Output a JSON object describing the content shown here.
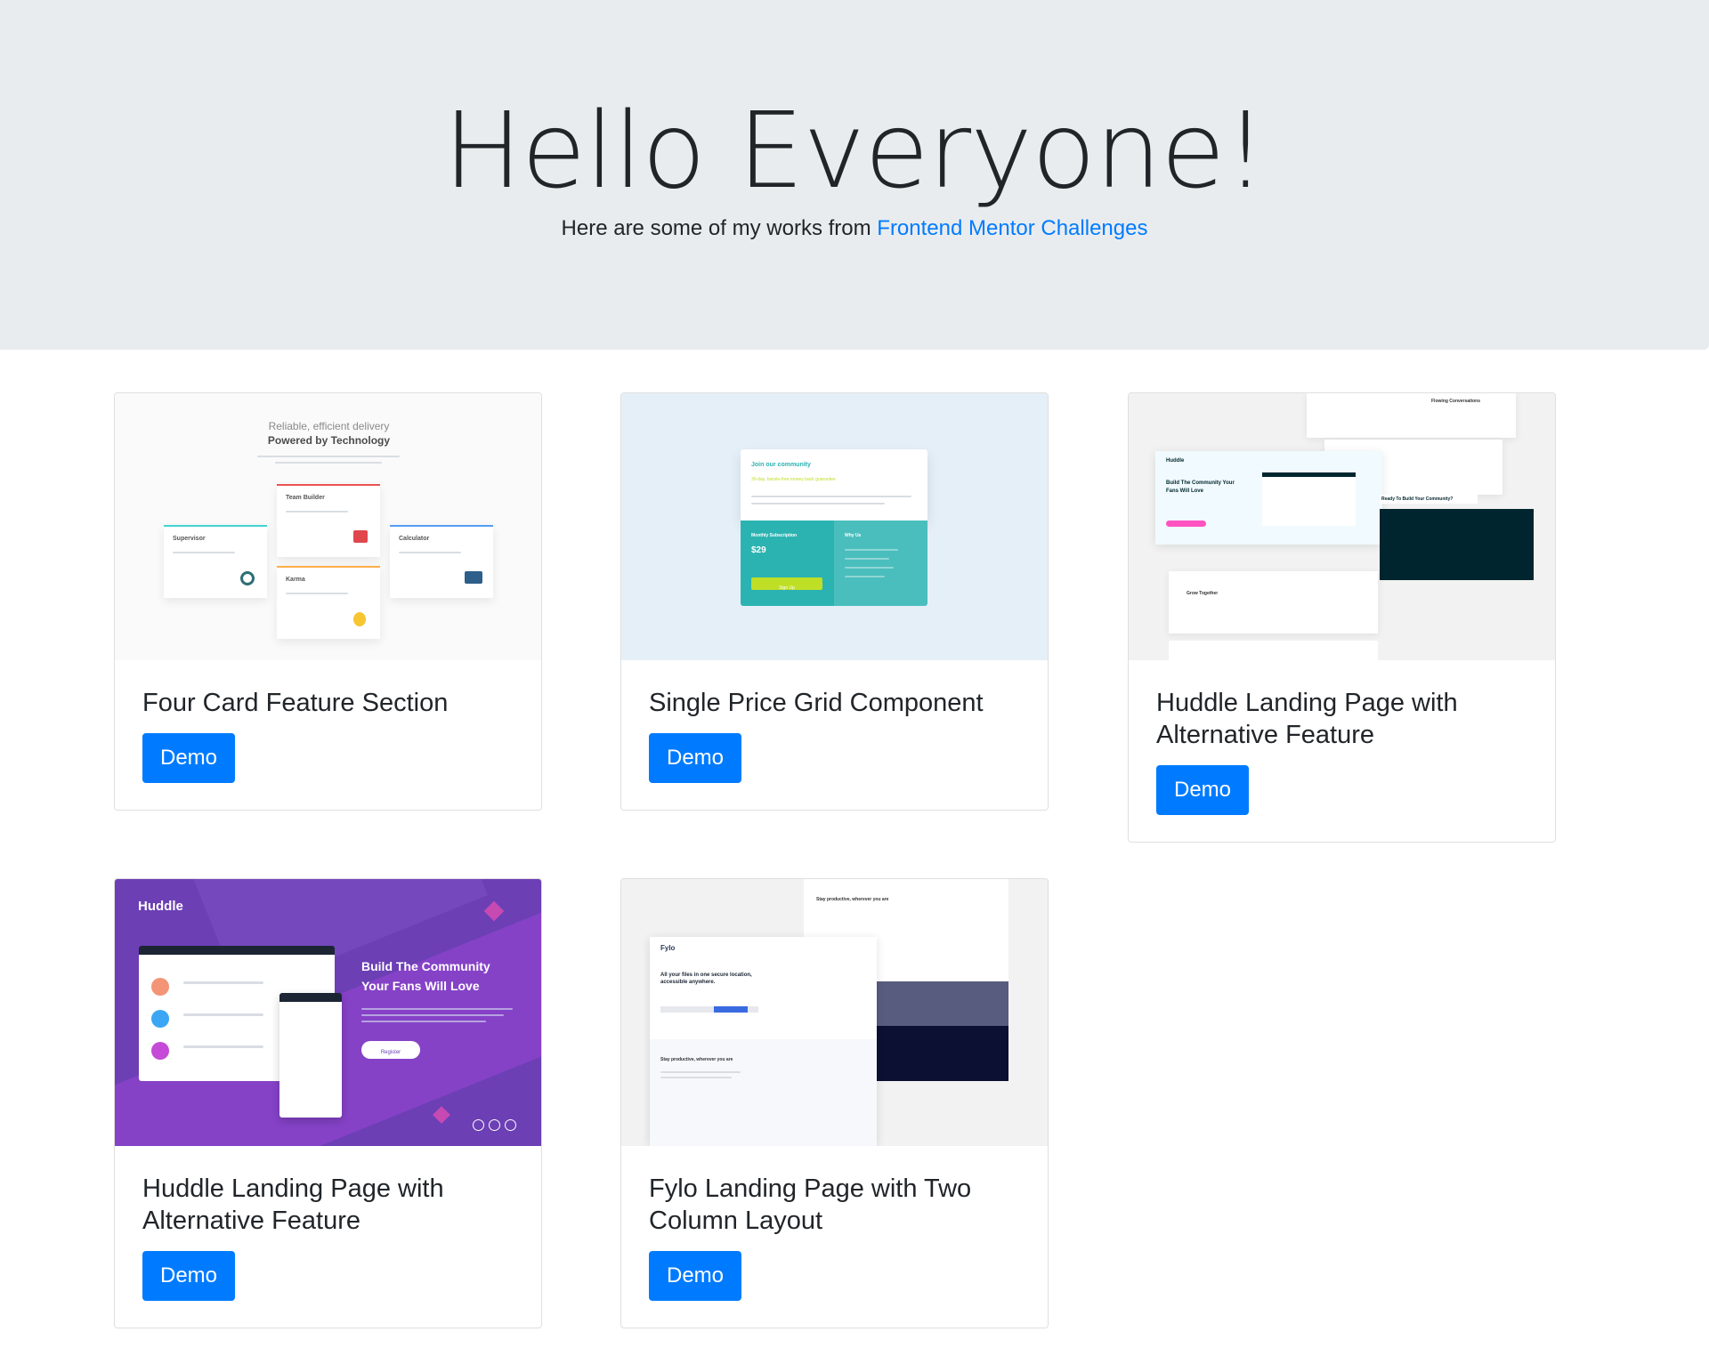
{
  "header": {
    "title": "Hello Everyone!",
    "subtitle_prefix": "Here are some of my works from ",
    "subtitle_link": "Frontend Mentor Challenges"
  },
  "cards": [
    {
      "title": "Four Card Feature Section",
      "button": "Demo",
      "preview": {
        "heading_light": "Reliable, efficient delivery",
        "heading_bold": "Powered by Technology",
        "cards": [
          "Supervisor",
          "Team Builder",
          "Karma",
          "Calculator"
        ]
      }
    },
    {
      "title": "Single Price Grid Component",
      "button": "Demo",
      "preview": {
        "join": "Join our community",
        "guarantee": "30-day, hassle-free money back guarantee",
        "monthly": "Monthly Subscription",
        "price": "$29",
        "why": "Why Us",
        "signup": "Sign Up"
      }
    },
    {
      "title": "Huddle Landing Page with Alternative Feature",
      "button": "Demo",
      "preview": {
        "logo": "Huddle",
        "headline": "Build The Community Your Fans Will Love",
        "flowing": "Flowing Conversations",
        "grow": "Grow Together",
        "ready": "Ready To Build Your Community?"
      }
    },
    {
      "title": "Huddle Landing Page with Alternative Feature",
      "button": "Demo",
      "preview": {
        "logo": "Huddle",
        "headline_1": "Build The Community",
        "headline_2": "Your Fans Will Love",
        "register": "Register"
      }
    },
    {
      "title": "Fylo Landing Page with Two Column Layout",
      "button": "Demo",
      "preview": {
        "logo": "Fylo",
        "headline": "All your files in one secure location, accessible anywhere.",
        "productive": "Stay productive, wherever you are"
      }
    }
  ],
  "colors": {
    "jumbotron_bg": "#e9ecef",
    "primary": "#007bff",
    "huddle_purple": "#6c3fb5",
    "price_teal": "#2bb3b1",
    "signup_green": "#bfdf26"
  }
}
